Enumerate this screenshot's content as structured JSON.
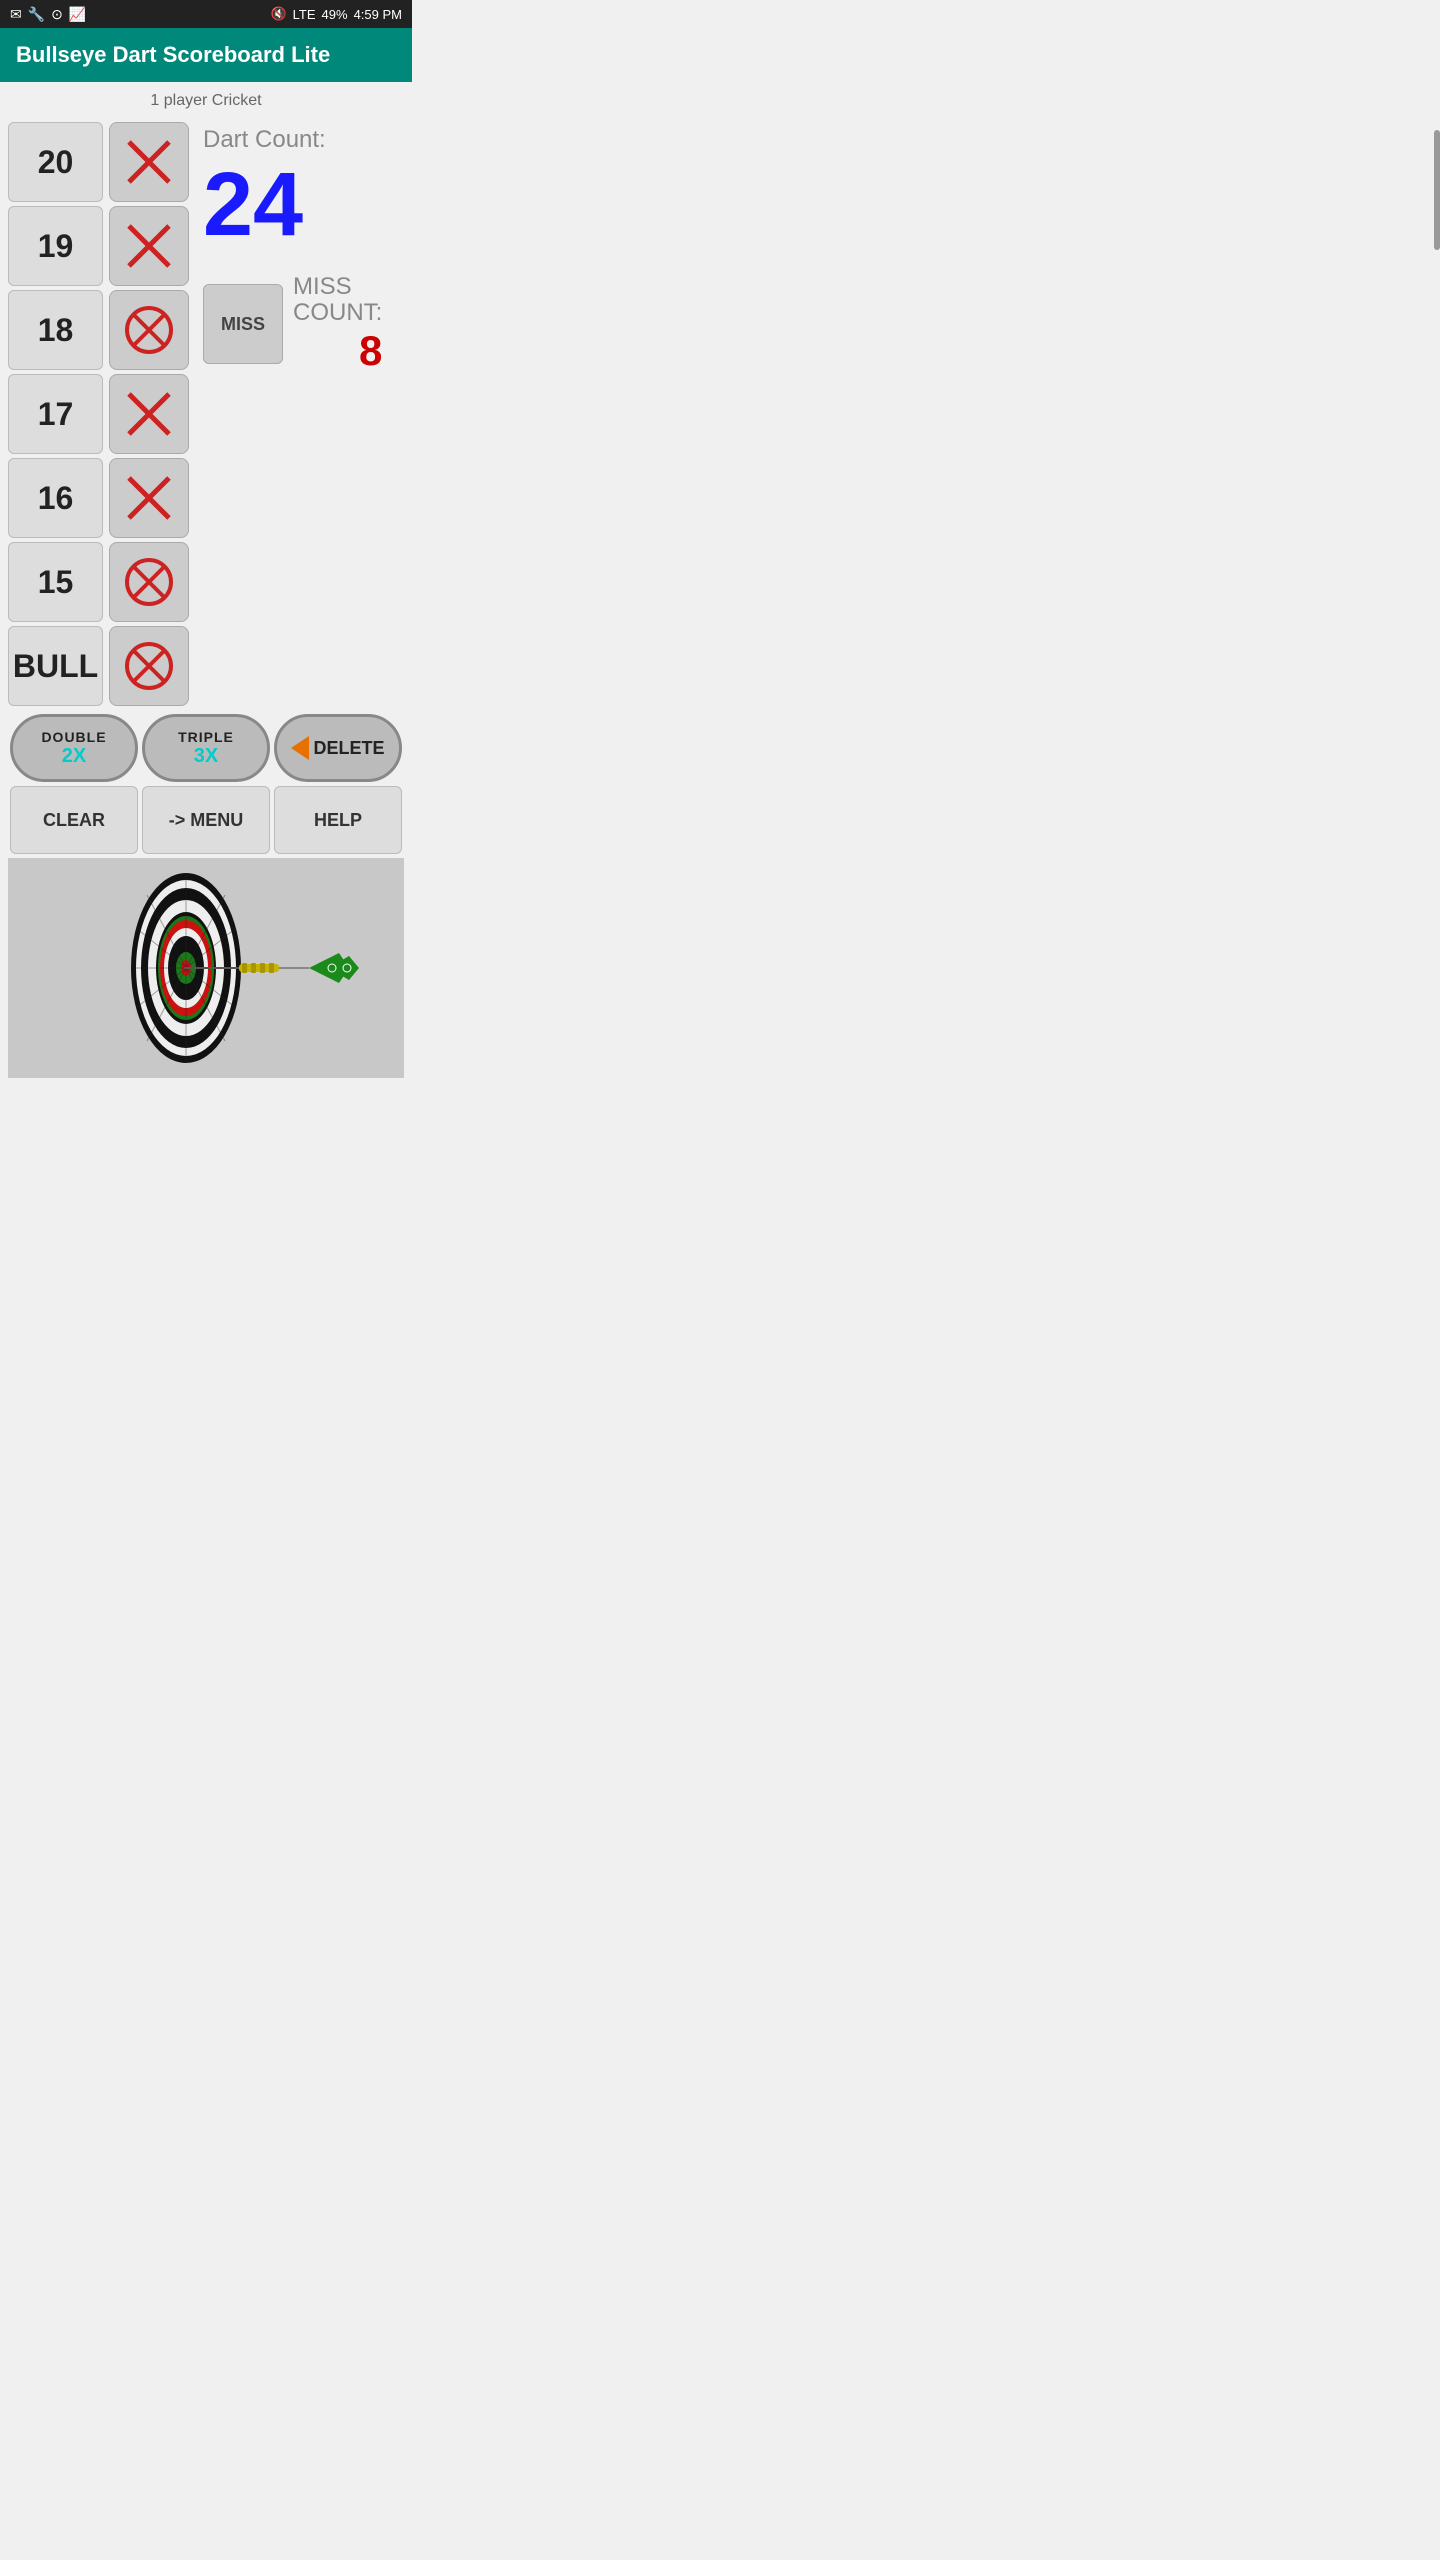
{
  "statusBar": {
    "leftIcons": [
      "✉",
      "🔧",
      "⊙",
      "📈"
    ],
    "signal": "LTE",
    "battery": "49%",
    "time": "4:59 PM"
  },
  "appBar": {
    "title": "Bullseye Dart Scoreboard Lite"
  },
  "gameMode": "1 player Cricket",
  "scoreRows": [
    {
      "number": "20",
      "markType": "double_x"
    },
    {
      "number": "19",
      "markType": "single_x"
    },
    {
      "number": "18",
      "markType": "circle_x"
    },
    {
      "number": "17",
      "markType": "double_x"
    },
    {
      "number": "16",
      "markType": "double_x"
    },
    {
      "number": "15",
      "markType": "circle_x"
    },
    {
      "number": "BULL",
      "markType": "circle_x"
    }
  ],
  "dartCount": {
    "label": "Dart Count:",
    "value": "24"
  },
  "missSection": {
    "btnLabel": "MISS",
    "countLabel": "MISS\nCOUNT:",
    "countValue": "8"
  },
  "actionButtons": {
    "double": {
      "topLabel": "DOUBLE",
      "bottomLabel": "2X"
    },
    "triple": {
      "topLabel": "TRIPLE",
      "bottomLabel": "3X"
    },
    "delete": {
      "label": "DELETE"
    }
  },
  "bottomButtons": {
    "clear": "CLEAR",
    "menu": "-> MENU",
    "help": "HELP"
  }
}
